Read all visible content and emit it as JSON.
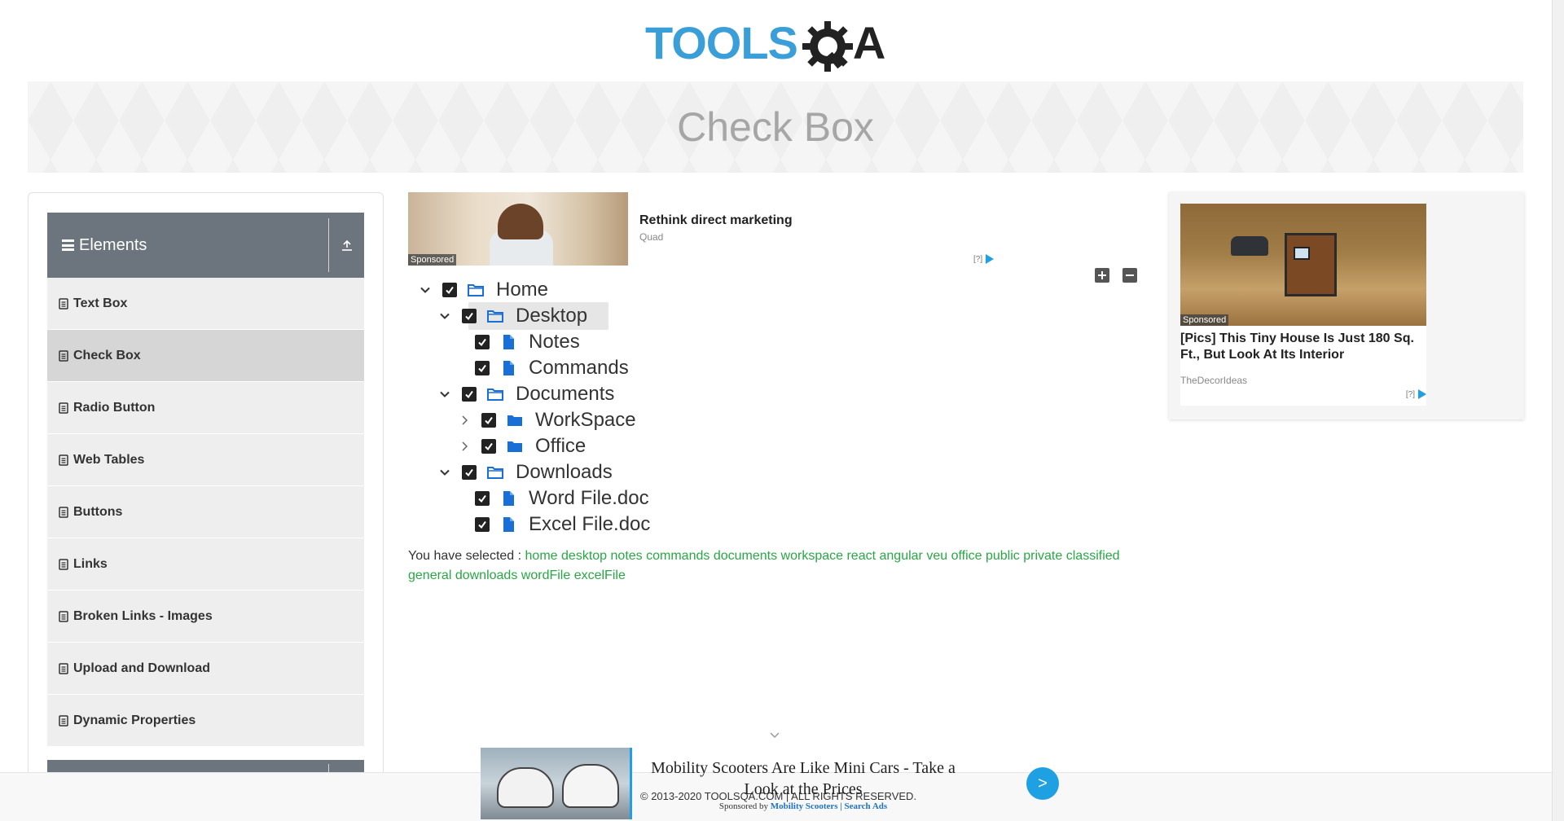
{
  "header": {
    "logo_text": "TOOLS",
    "logo_suffix": "A"
  },
  "banner": {
    "title": "Check Box"
  },
  "sidebar": {
    "group_title": "Elements",
    "items": [
      {
        "label": "Text Box"
      },
      {
        "label": "Check Box",
        "active": true
      },
      {
        "label": "Radio Button"
      },
      {
        "label": "Web Tables"
      },
      {
        "label": "Buttons"
      },
      {
        "label": "Links"
      },
      {
        "label": "Broken Links - Images"
      },
      {
        "label": "Upload and Download"
      },
      {
        "label": "Dynamic Properties"
      }
    ]
  },
  "ad_top": {
    "title": "Rethink direct marketing",
    "source": "Quad",
    "sponsored": "Sponsored",
    "choice": "[?]"
  },
  "tree": {
    "nodes": [
      {
        "label": "Home",
        "checked": true,
        "expanded": true,
        "type": "folder"
      },
      {
        "label": "Desktop",
        "checked": true,
        "expanded": true,
        "type": "folder",
        "highlight": true
      },
      {
        "label": "Notes",
        "checked": true,
        "type": "file"
      },
      {
        "label": "Commands",
        "checked": true,
        "type": "file"
      },
      {
        "label": "Documents",
        "checked": true,
        "expanded": true,
        "type": "folder"
      },
      {
        "label": "WorkSpace",
        "checked": true,
        "expanded": false,
        "type": "folder-closed"
      },
      {
        "label": "Office",
        "checked": true,
        "expanded": false,
        "type": "folder-closed"
      },
      {
        "label": "Downloads",
        "checked": true,
        "expanded": true,
        "type": "folder"
      },
      {
        "label": "Word File.doc",
        "checked": true,
        "type": "file"
      },
      {
        "label": "Excel File.doc",
        "checked": true,
        "type": "file"
      }
    ],
    "expand_all": "expand-all",
    "collapse_all": "collapse-all"
  },
  "result": {
    "prefix": "You have selected :",
    "selected": [
      "home",
      "desktop",
      "notes",
      "commands",
      "documents",
      "workspace",
      "react",
      "angular",
      "veu",
      "office",
      "public",
      "private",
      "classified",
      "general",
      "downloads",
      "wordFile",
      "excelFile"
    ]
  },
  "ad_right": {
    "title": "[Pics] This Tiny House Is Just 180 Sq. Ft., But Look At Its Interior",
    "source": "TheDecorIdeas",
    "sponsored": "Sponsored",
    "choice": "[?]"
  },
  "ad_bottom": {
    "title": "Mobility Scooters Are Like Mini Cars - Take a Look at the Prices",
    "sponsored_by": "Sponsored by",
    "sponsor_link": "Mobility Scooters | Search Ads",
    "go": ">"
  },
  "footer": {
    "text": "© 2013-2020 TOOLSQA.COM | ALL RIGHTS RESERVED."
  },
  "colors": {
    "accent": "#28a745",
    "sidebar_header": "#6c757d",
    "logo_blue": "#3a9ed8"
  }
}
